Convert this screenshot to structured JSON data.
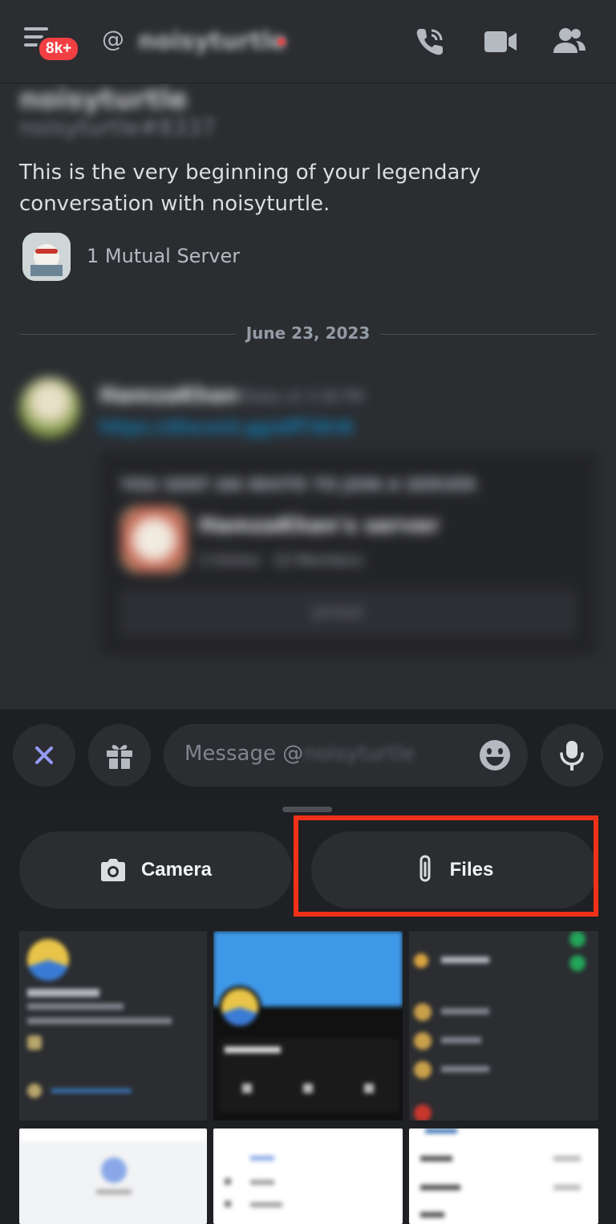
{
  "header": {
    "badge": "8k+",
    "at_symbol": "@",
    "recipient": "noisyturtle"
  },
  "intro": {
    "display_name": "noisyturtle",
    "user_tag": "noisyturtle#8337",
    "text": "This is the very beginning of your legendary conversation with noisyturtle.",
    "mutual_servers": "1 Mutual Server"
  },
  "date_divider": "June 23, 2023",
  "message": {
    "author": "HamzaKhan",
    "time": "Today at 3:36 PM",
    "link": "https://discord.gg/aRTdIn6",
    "invite": {
      "title": "YOU SENT AN INVITE TO JOIN A SERVER",
      "server_name": "HamzaKhan's server",
      "stats": "3 Online · 10 Members",
      "button": "Joined"
    }
  },
  "input": {
    "placeholder_prefix": "Message @",
    "placeholder_user": "noisyturtle"
  },
  "sheet": {
    "camera_label": "Camera",
    "files_label": "Files"
  },
  "colors": {
    "background": "#2b2d31",
    "input_bar": "#1e1f22",
    "sheet": "#1f2023",
    "badge": "#f23f43",
    "highlight": "#f0311a",
    "link": "#00a8fc"
  }
}
